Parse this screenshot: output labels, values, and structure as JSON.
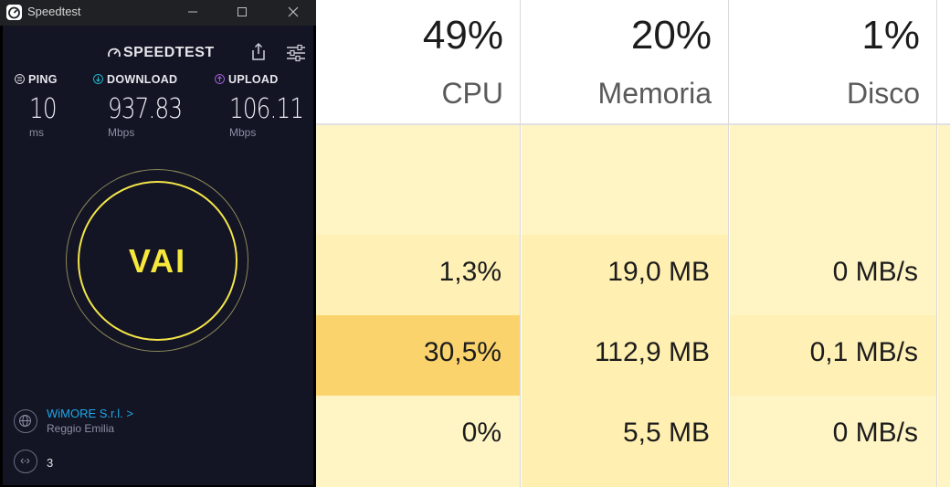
{
  "speedtest": {
    "window_title": "Speedtest",
    "brand": "SPEEDTEST",
    "ping": {
      "label": "PING",
      "value": "10",
      "unit": "ms"
    },
    "download": {
      "label": "DOWNLOAD",
      "value": "937.83",
      "unit": "Mbps"
    },
    "upload": {
      "label": "UPLOAD",
      "value": "106.11",
      "unit": "Mbps"
    },
    "go_button": "VAI",
    "isp": {
      "name": "WiMORE S.r.l. >",
      "location": "Reggio Emilia"
    },
    "connections": "3",
    "colors": {
      "background": "#131424",
      "accent_yellow": "#f6e83a",
      "download_icon": "#21b7c9",
      "upload_icon": "#a35fd8",
      "isp_link": "#1ea8e8"
    }
  },
  "task_manager": {
    "columns": [
      {
        "percent": "49%",
        "name": "CPU"
      },
      {
        "percent": "20%",
        "name": "Memoria"
      },
      {
        "percent": "1%",
        "name": "Disco"
      }
    ],
    "rows": [
      {
        "cells": [
          "",
          "",
          ""
        ],
        "shade": [
          "#fff4c4",
          "#fff4c4",
          "#fff4c4"
        ]
      },
      {
        "cells": [
          "1,3%",
          "19,0 MB",
          "0 MB/s"
        ],
        "shade": [
          "#fff0b5",
          "#ffefb0",
          "#fff4c4"
        ]
      },
      {
        "cells": [
          "30,5%",
          "112,9 MB",
          "0,1 MB/s"
        ],
        "shade": [
          "#fbd36d",
          "#ffefb0",
          "#fff0b5"
        ]
      },
      {
        "cells": [
          "0%",
          "5,5 MB",
          "0 MB/s"
        ],
        "shade": [
          "#fff4c4",
          "#ffefb0",
          "#fff4c4"
        ]
      }
    ]
  }
}
